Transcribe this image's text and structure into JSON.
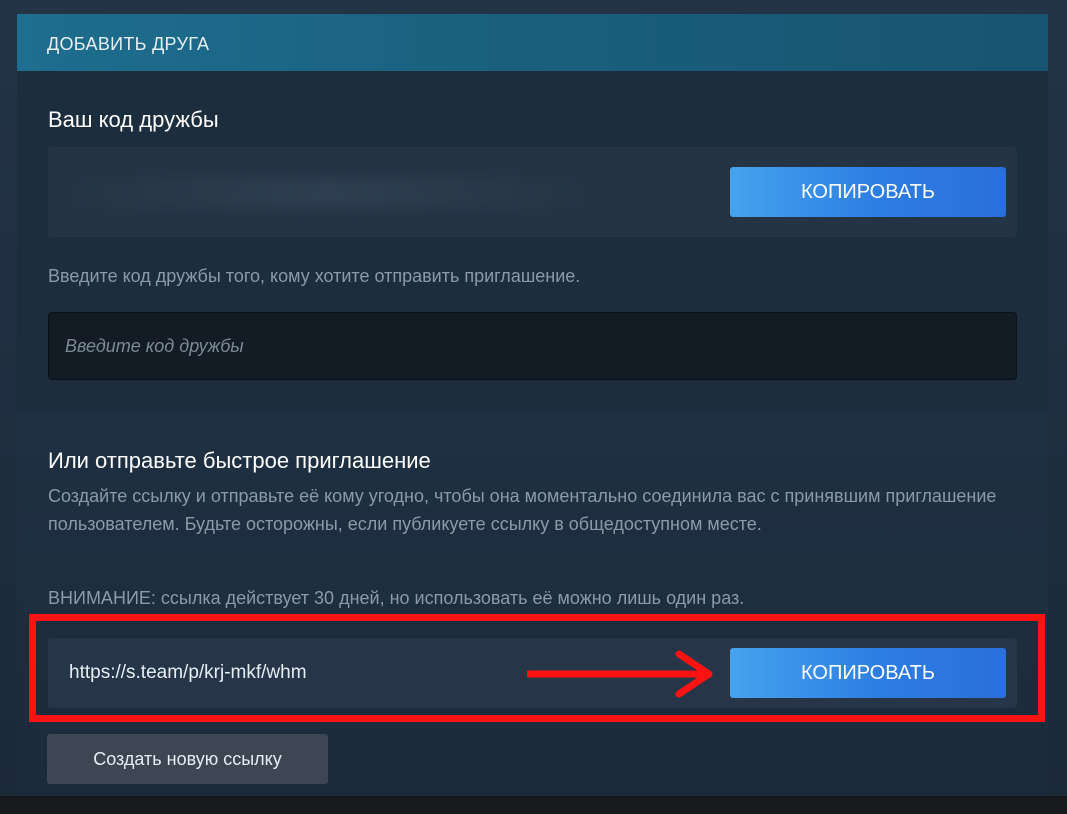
{
  "header": {
    "title": "ДОБАВИТЬ ДРУГА"
  },
  "friend_code": {
    "title": "Ваш код дружбы",
    "copy_label": "КОПИРОВАТЬ",
    "instruction": "Введите код дружбы того, кому хотите отправить приглашение.",
    "input_placeholder": "Введите код дружбы",
    "input_value": ""
  },
  "quick_invite": {
    "title": "Или отправьте быстрое приглашение",
    "description": "Создайте ссылку и отправьте её кому угодно, чтобы она моментально соединила вас с принявшим приглашение пользователем. Будьте осторожны, если публикуете ссылку в общедоступном месте.",
    "warning": "ВНИМАНИЕ: ссылка действует 30 дней, но использовать её можно лишь один раз.",
    "link": "https://s.team/p/krj-mkf/whm",
    "copy_label": "КОПИРОВАТЬ",
    "new_link_label": "Создать новую ссылку"
  },
  "annotation": {
    "highlight_color": "#ff1212",
    "arrow_icon": "right-arrow-icon"
  },
  "colors": {
    "accent_button": "#2d7de3",
    "header_bar": "#1a5f7d",
    "panel_bg": "#1c2d3e"
  }
}
